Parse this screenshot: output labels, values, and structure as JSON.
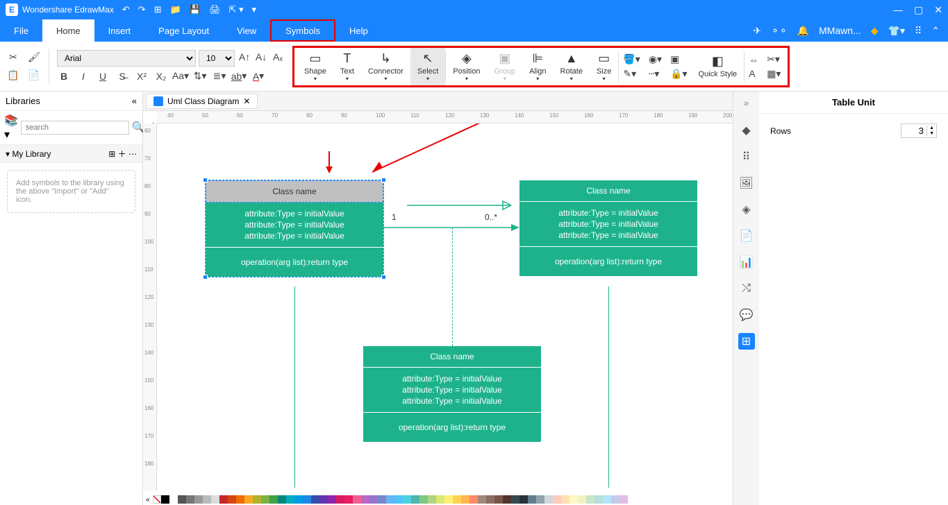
{
  "app": {
    "title": "Wondershare EdrawMax",
    "user": "MMawn..."
  },
  "menu": [
    "File",
    "Home",
    "Insert",
    "Page Layout",
    "View",
    "Symbols",
    "Help"
  ],
  "font": {
    "family": "Arial",
    "size": "10"
  },
  "symbolbar": {
    "shape": "Shape",
    "text": "Text",
    "connector": "Connector",
    "select": "Select",
    "position": "Position",
    "group": "Group",
    "align": "Align",
    "rotate": "Rotate",
    "size": "Size",
    "quickstyle": "Quick Style"
  },
  "libraries": {
    "title": "Libraries",
    "placeholder": "search",
    "mylib": "My Library",
    "empty": "Add symbols to the library using the above \"Import\" or \"Add\" icon."
  },
  "tab": {
    "title": "Uml Class Diagram"
  },
  "rulerH": [
    "40",
    "50",
    "60",
    "70",
    "80",
    "90",
    "100",
    "110",
    "120",
    "130",
    "140",
    "150",
    "160",
    "170",
    "180",
    "190",
    "200"
  ],
  "rulerV": [
    "60",
    "70",
    "80",
    "90",
    "100",
    "110",
    "120",
    "130",
    "140",
    "150",
    "160",
    "170",
    "180"
  ],
  "uml": {
    "name": "Class name",
    "attr": "attribute:Type = initialValue",
    "op": "operation(arg list):return type",
    "mult1": "1",
    "multN": "0..*"
  },
  "rightPanel": {
    "title": "Table Unit",
    "rowsLabel": "Rows",
    "rows": "3"
  },
  "colors": [
    "#000",
    "#fff",
    "#555",
    "#777",
    "#999",
    "#bbb",
    "#ddd",
    "#c62828",
    "#d84315",
    "#ef6c00",
    "#f9a825",
    "#afb42b",
    "#7cb342",
    "#43a047",
    "#00897b",
    "#00acc1",
    "#039be5",
    "#1e88e5",
    "#3949ab",
    "#5e35b1",
    "#8e24aa",
    "#d81b60",
    "#e91e63",
    "#f06292",
    "#ba68c8",
    "#9575cd",
    "#7986cb",
    "#64b5f6",
    "#4fc3f7",
    "#4dd0e1",
    "#4db6ac",
    "#81c784",
    "#aed581",
    "#dce775",
    "#fff176",
    "#ffd54f",
    "#ffb74d",
    "#ff8a65",
    "#a1887f",
    "#8d6e63",
    "#795548",
    "#4e342e",
    "#37474f",
    "#263238",
    "#607d8b",
    "#90a4ae",
    "#cfd8dc",
    "#ffccbc",
    "#ffe0b2",
    "#fff9c4",
    "#f0f4c3",
    "#c8e6c9",
    "#b2dfdb",
    "#b3e5fc",
    "#c5cae9",
    "#e1bee7"
  ]
}
